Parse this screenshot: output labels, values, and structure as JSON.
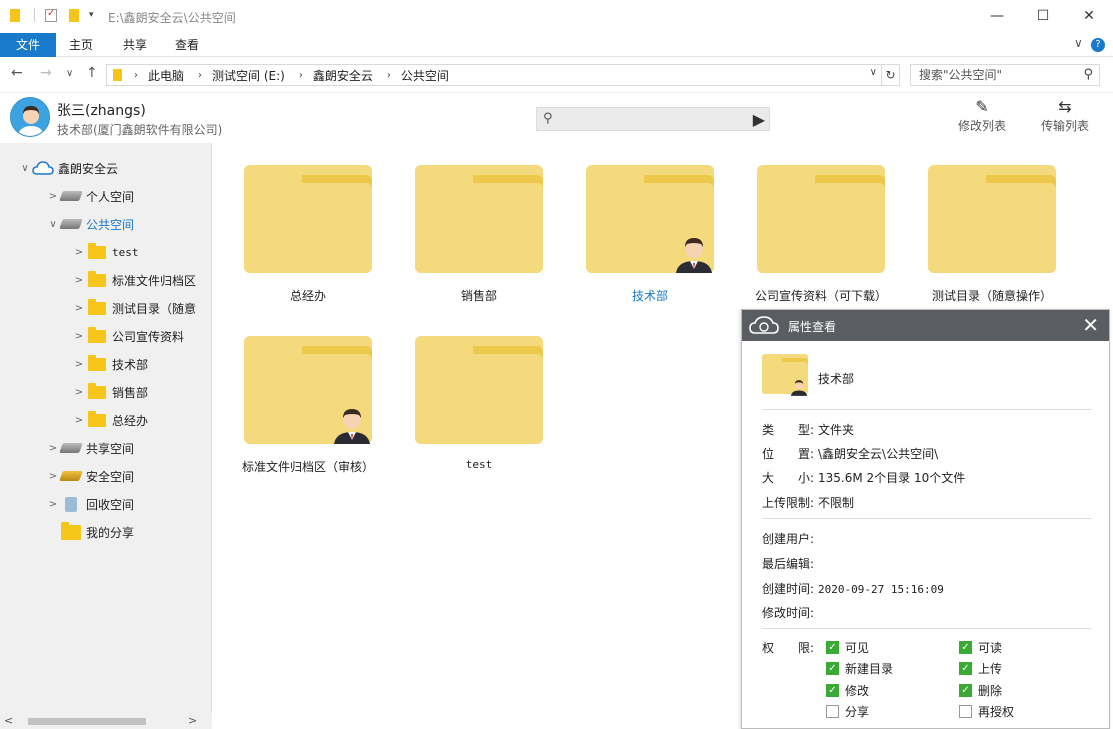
{
  "window": {
    "title": "E:\\鑫朗安全云\\公共空间",
    "minimize": "—",
    "maximize": "☐",
    "close": "✕"
  },
  "ribbon": {
    "tabs": [
      "文件",
      "主页",
      "共享",
      "查看"
    ],
    "help": "?",
    "collapse": "∨"
  },
  "nav": {
    "back": "←",
    "forward": "→",
    "recent": "∨",
    "up": "↑",
    "breadcrumb": [
      "此电脑",
      "测试空间 (E:)",
      "鑫朗安全云",
      "公共空间"
    ],
    "search_placeholder": "搜索\"公共空间\""
  },
  "user": {
    "name": "张三(zhangs)",
    "dept": "技术部(厦门鑫朗软件有限公司)",
    "tools": [
      {
        "label": "修改列表",
        "icon": "edit-icon"
      },
      {
        "label": "传输列表",
        "icon": "transfer-icon"
      }
    ]
  },
  "sidebar": {
    "items": [
      {
        "label": "鑫朗安全云",
        "level": 0,
        "expander": "∨",
        "icon": "cloud"
      },
      {
        "label": "个人空间",
        "level": 1,
        "expander": ">",
        "icon": "drive"
      },
      {
        "label": "公共空间",
        "level": 1,
        "expander": "∨",
        "icon": "drive",
        "selected": true
      },
      {
        "label": "test",
        "level": 2,
        "expander": ">",
        "icon": "folder"
      },
      {
        "label": "标准文件归档区",
        "level": 2,
        "expander": ">",
        "icon": "folder"
      },
      {
        "label": "测试目录（随意",
        "level": 2,
        "expander": ">",
        "icon": "folder"
      },
      {
        "label": "公司宣传资料",
        "level": 2,
        "expander": ">",
        "icon": "folder"
      },
      {
        "label": "技术部",
        "level": 2,
        "expander": ">",
        "icon": "folder"
      },
      {
        "label": "销售部",
        "level": 2,
        "expander": ">",
        "icon": "folder"
      },
      {
        "label": "总经办",
        "level": 2,
        "expander": ">",
        "icon": "folder"
      },
      {
        "label": "共享空间",
        "level": 1,
        "expander": ">",
        "icon": "drive"
      },
      {
        "label": "安全空间",
        "level": 1,
        "expander": ">",
        "icon": "drive"
      },
      {
        "label": "回收空间",
        "level": 1,
        "expander": ">",
        "icon": "recycle"
      },
      {
        "label": "我的分享",
        "level": 1,
        "expander": "",
        "icon": "share-folder"
      }
    ],
    "scroll_left": "<",
    "scroll_right": ">"
  },
  "folders": [
    {
      "name": "总经办",
      "owner": false
    },
    {
      "name": "销售部",
      "owner": false
    },
    {
      "name": "技术部",
      "owner": true,
      "selected": true
    },
    {
      "name": "公司宣传资料（可下载）",
      "owner": false
    },
    {
      "name": "测试目录（随意操作）",
      "owner": false
    },
    {
      "name": "标准文件归档区（审核）",
      "owner": true
    },
    {
      "name": "test",
      "owner": false
    }
  ],
  "panel": {
    "title": "属性查看",
    "close": "✕",
    "folder_name": "技术部",
    "rows": [
      {
        "key": "类　　型:",
        "value": "文件夹"
      },
      {
        "key": "位　　置:",
        "value": "\\鑫朗安全云\\公共空间\\"
      },
      {
        "key": "大　　小:",
        "value": "135.6M  2个目录  10个文件"
      },
      {
        "key": "上传限制:",
        "value": "不限制"
      },
      {
        "key": "创建用户:",
        "value": ""
      },
      {
        "key": "最后编辑:",
        "value": ""
      },
      {
        "key": "创建时间:",
        "value": "2020-09-27 15:16:09"
      },
      {
        "key": "修改时间:",
        "value": ""
      }
    ],
    "perm_label": "权　　限:",
    "permissions": [
      {
        "label": "可见",
        "checked": true
      },
      {
        "label": "可读",
        "checked": true
      },
      {
        "label": "新建目录",
        "checked": true
      },
      {
        "label": "上传",
        "checked": true
      },
      {
        "label": "修改",
        "checked": true
      },
      {
        "label": "删除",
        "checked": true
      },
      {
        "label": "分享",
        "checked": false
      },
      {
        "label": "再授权",
        "checked": false
      }
    ]
  }
}
